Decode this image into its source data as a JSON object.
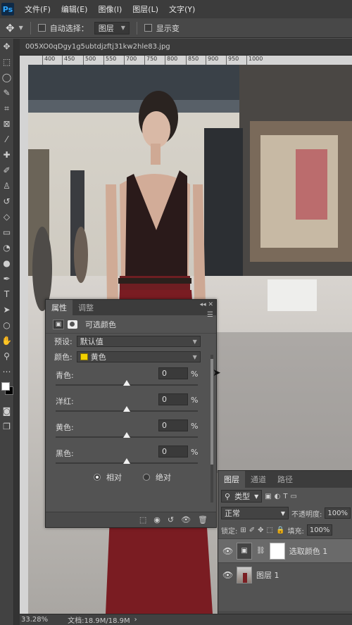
{
  "menubar": {
    "logo": "Ps",
    "items": [
      "文件(F)",
      "编辑(E)",
      "图像(I)",
      "图层(L)",
      "文字(Y)"
    ]
  },
  "options": {
    "autoselect_label": "自动选择：",
    "autoselect_value": "图层",
    "show_transform_label": "显示变"
  },
  "document": {
    "tab_title": "005XO0qDgy1g5ubtdjzftj31kw2hle83.jpg",
    "ruler_ticks": [
      "400",
      "450",
      "500",
      "550",
      "700",
      "750",
      "800",
      "850",
      "900",
      "950",
      "1000"
    ],
    "zoom": "33.28%",
    "doc_info": "文档:18.9M/18.9M"
  },
  "properties": {
    "tabs": [
      "属性",
      "调整"
    ],
    "title": "可选颜色",
    "preset_label": "预设:",
    "preset_value": "默认值",
    "color_label": "颜色:",
    "color_value": "黄色",
    "color_swatch": "#f2d100",
    "sliders": [
      {
        "label": "青色:",
        "value": "0",
        "pct": "%",
        "pos": 0.5
      },
      {
        "label": "洋红:",
        "value": "0",
        "pct": "%",
        "pos": 0.5
      },
      {
        "label": "黄色:",
        "value": "0",
        "pct": "%",
        "pos": 0.5
      },
      {
        "label": "黑色:",
        "value": "0",
        "pct": "%",
        "pos": 0.5
      }
    ],
    "mode_relative": "相对",
    "mode_absolute": "绝对",
    "selected_mode": "relative"
  },
  "layers_panel": {
    "tabs": [
      "图层",
      "通道",
      "路径"
    ],
    "filter_kind": "类型",
    "blend_mode": "正常",
    "opacity_label": "不透明度:",
    "opacity_value": "100%",
    "lock_label": "锁定:",
    "fill_label": "填充:",
    "fill_value": "100%",
    "layers": [
      {
        "name": "选取颜色 1",
        "selected": true
      },
      {
        "name": "图层 1",
        "selected": false
      }
    ]
  }
}
